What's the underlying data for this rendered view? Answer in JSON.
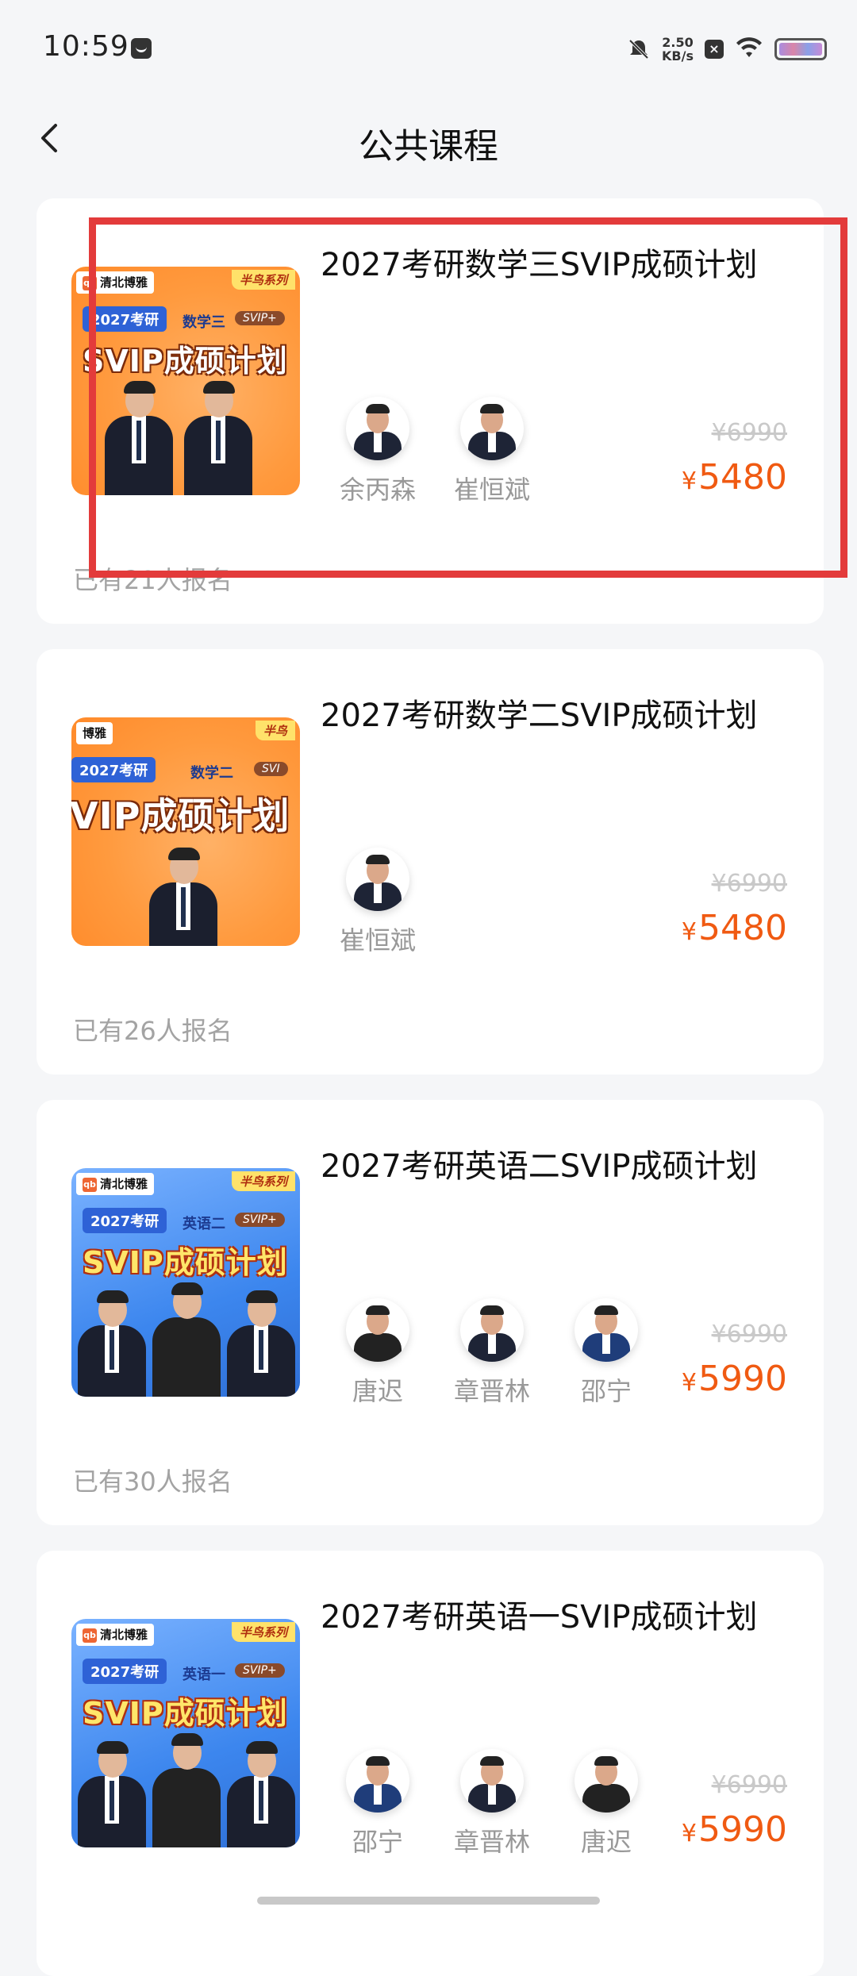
{
  "status_bar": {
    "time": "10:59",
    "net_speed_value": "2.50",
    "net_speed_unit": "KB/s"
  },
  "nav": {
    "title": "公共课程"
  },
  "courses": [
    {
      "title": "2027考研数学三SVIP成硕计划",
      "teachers": [
        "余丙森",
        "崔恒斌"
      ],
      "original_price": "¥6990",
      "price_symbol": "¥",
      "price": "5480",
      "enrollment": "已有21人报名",
      "cover": {
        "logo": "清北博雅",
        "series": "半鸟系列",
        "year_tag": "2027考研",
        "subject": "数学三",
        "svip_tag": "SVIP+",
        "headline": "SVIP成硕计划"
      }
    },
    {
      "title": "2027考研数学二SVIP成硕计划",
      "teachers": [
        "崔恒斌"
      ],
      "original_price": "¥6990",
      "price_symbol": "¥",
      "price": "5480",
      "enrollment": "已有26人报名",
      "cover": {
        "logo": "博雅",
        "series": "半鸟",
        "year_tag": "2027考研",
        "subject": "数学二",
        "svip_tag": "SVI",
        "headline": "VIP成硕计划"
      }
    },
    {
      "title": "2027考研英语二SVIP成硕计划",
      "teachers": [
        "唐迟",
        "章晋林",
        "邵宁"
      ],
      "original_price": "¥6990",
      "price_symbol": "¥",
      "price": "5990",
      "enrollment": "已有30人报名",
      "cover": {
        "logo": "清北博雅",
        "series": "半鸟系列",
        "year_tag": "2027考研",
        "subject": "英语二",
        "svip_tag": "SVIP+",
        "headline": "SVIP成硕计划"
      }
    },
    {
      "title": "2027考研英语一SVIP成硕计划",
      "teachers": [
        "邵宁",
        "章晋林",
        "唐迟"
      ],
      "original_price": "¥6990",
      "price_symbol": "¥",
      "price": "5990",
      "enrollment": "",
      "cover": {
        "logo": "清北博雅",
        "series": "半鸟系列",
        "year_tag": "2027考研",
        "subject": "英语一",
        "svip_tag": "SVIP+",
        "headline": "SVIP成硕计划"
      }
    }
  ],
  "colors": {
    "price": "#f05a12",
    "highlight": "#e33b3b",
    "background": "#f5f6f8"
  }
}
